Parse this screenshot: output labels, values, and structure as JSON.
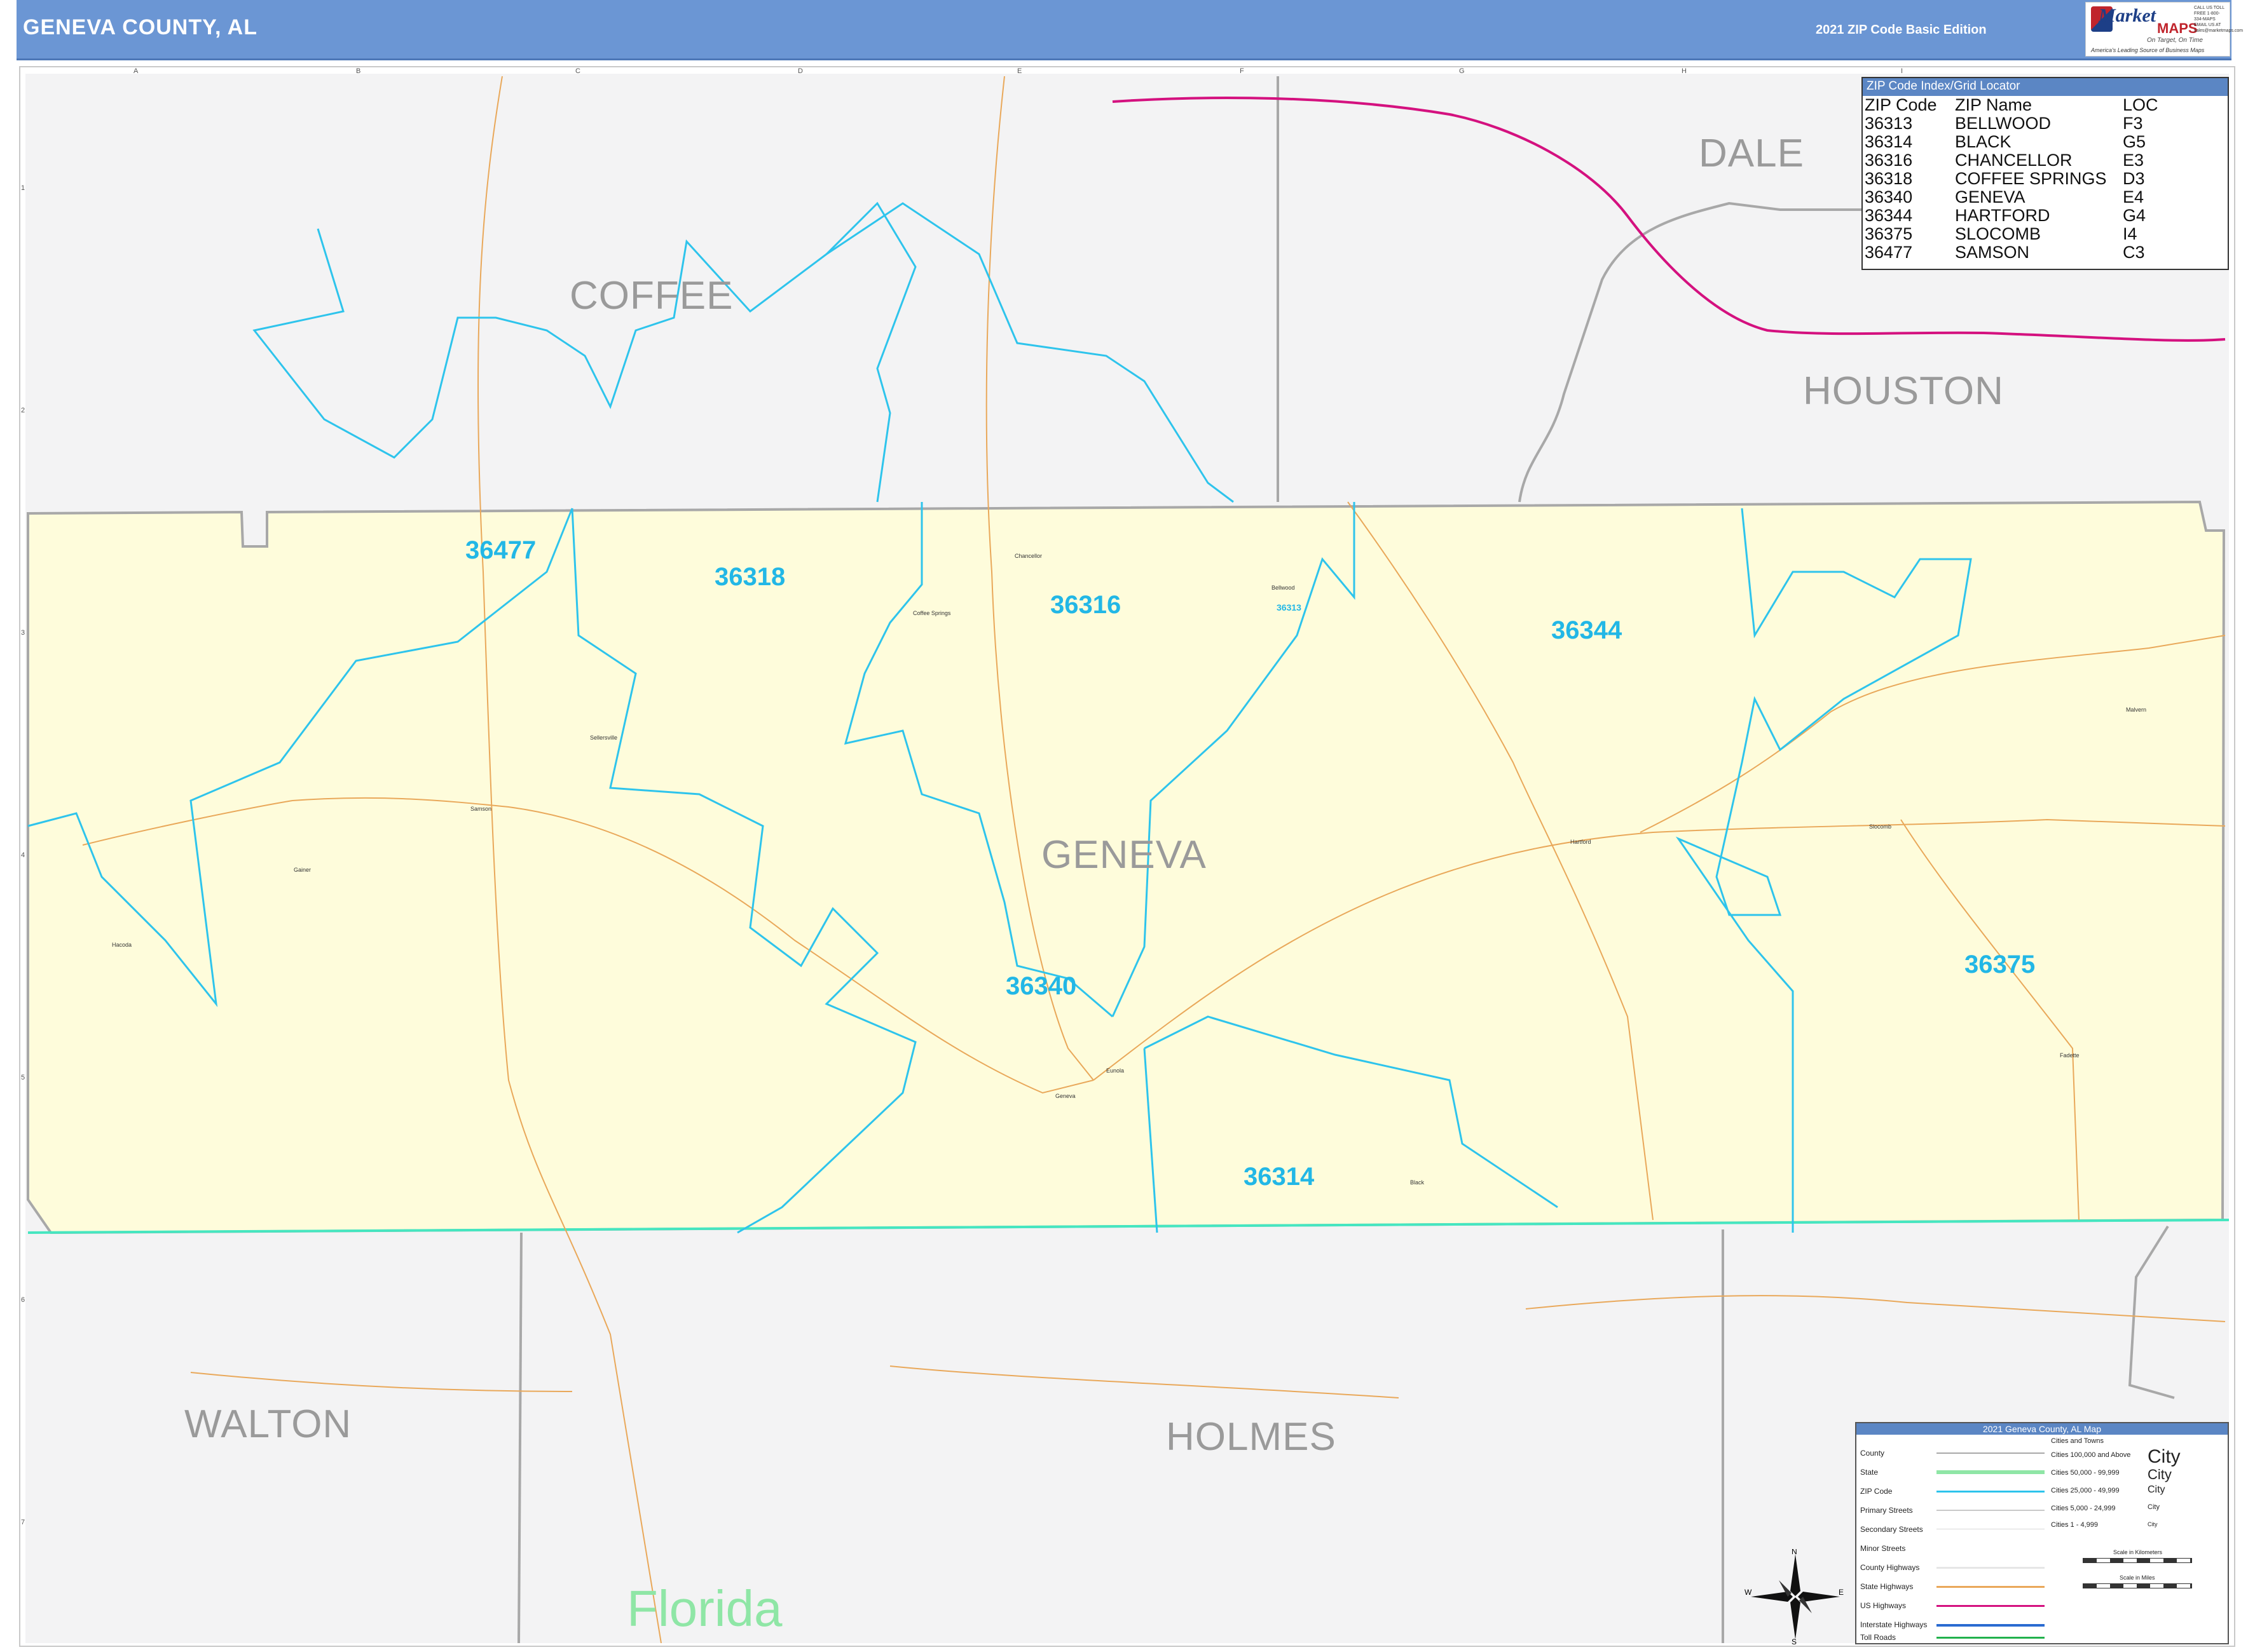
{
  "header": {
    "title": "GENEVA COUNTY, AL",
    "edition": "2021 ZIP Code Basic Edition",
    "logo_brand": "Market",
    "logo_accent": "MAPS",
    "logo_tagline": "On Target, On Time",
    "logo_tagline2": "America's Leading Source of Business Maps",
    "logo_contact": "CALL US TOLL FREE 1-800-334-MAPS EMAIL US AT sales@marketmaps.com"
  },
  "zip_index": {
    "title": "ZIP Code Index/Grid Locator",
    "columns": [
      "ZIP Code",
      "ZIP Name",
      "LOC"
    ],
    "rows": [
      [
        "36313",
        "BELLWOOD",
        "F3"
      ],
      [
        "36314",
        "BLACK",
        "G5"
      ],
      [
        "36316",
        "CHANCELLOR",
        "E3"
      ],
      [
        "36318",
        "COFFEE SPRINGS",
        "D3"
      ],
      [
        "36340",
        "GENEVA",
        "E4"
      ],
      [
        "36344",
        "HARTFORD",
        "G4"
      ],
      [
        "36375",
        "SLOCOMB",
        "I4"
      ],
      [
        "36477",
        "SAMSON",
        "C3"
      ]
    ]
  },
  "counties": {
    "dale": "DALE",
    "coffee": "COFFEE",
    "houston": "HOUSTON",
    "geneva": "GENEVA",
    "walton": "WALTON",
    "holmes": "HOLMES"
  },
  "state": "Florida",
  "zips": {
    "z36477": "36477",
    "z36318": "36318",
    "z36316": "36316",
    "z36313": "36313",
    "z36344": "36344",
    "z36340": "36340",
    "z36375": "36375",
    "z36314": "36314"
  },
  "towns": {
    "chancellor": "Chancellor",
    "coffee_springs": "Coffee Springs",
    "bellwood": "Bellwood",
    "samson": "Samson",
    "geneva": "Geneva",
    "hartford": "Hartford",
    "slocomb": "Slocomb",
    "black": "Black",
    "eunola": "Eunola",
    "malvern": "Malvern",
    "fadette": "Fadette",
    "hacoda": "Hacoda",
    "gainer": "Gainer",
    "sellersville": "Sellersville"
  },
  "grid": {
    "columns": [
      "A",
      "B",
      "C",
      "D",
      "E",
      "F",
      "G",
      "H",
      "I"
    ],
    "rows": [
      "1",
      "2",
      "3",
      "4",
      "5",
      "6",
      "7"
    ]
  },
  "legend": {
    "title": "2021 Geneva County, AL Map",
    "items": [
      "County",
      "State",
      "ZIP Code",
      "Primary Streets",
      "Secondary Streets",
      "Minor Streets",
      "County Highways",
      "State Highways",
      "US Highways",
      "Interstate Highways",
      "Toll Roads"
    ],
    "cities_header": "Cities and Towns",
    "city_classes": [
      "Cities 100,000 and Above",
      "Cities 50,000 - 99,999",
      "Cities 25,000 - 49,999",
      "Cities 5,000 - 24,999",
      "Cities 1 - 4,999"
    ],
    "city_samples": [
      "City",
      "City",
      "City",
      "City",
      "City"
    ],
    "scale_km": "Scale in Kilometers",
    "scale_mi": "Scale in Miles"
  },
  "compass": {
    "n": "N",
    "s": "S",
    "e": "E",
    "w": "W"
  },
  "colors": {
    "county_fill": "#fefcdb",
    "outside_fill": "#f3f3f4",
    "zip_line": "#2ec4ec",
    "state_line": "#45e6c0",
    "county_line": "#a8a8a8",
    "us_highway": "#d4117f",
    "minor_road": "#e9a85a",
    "header_bg": "#6b96d4"
  }
}
